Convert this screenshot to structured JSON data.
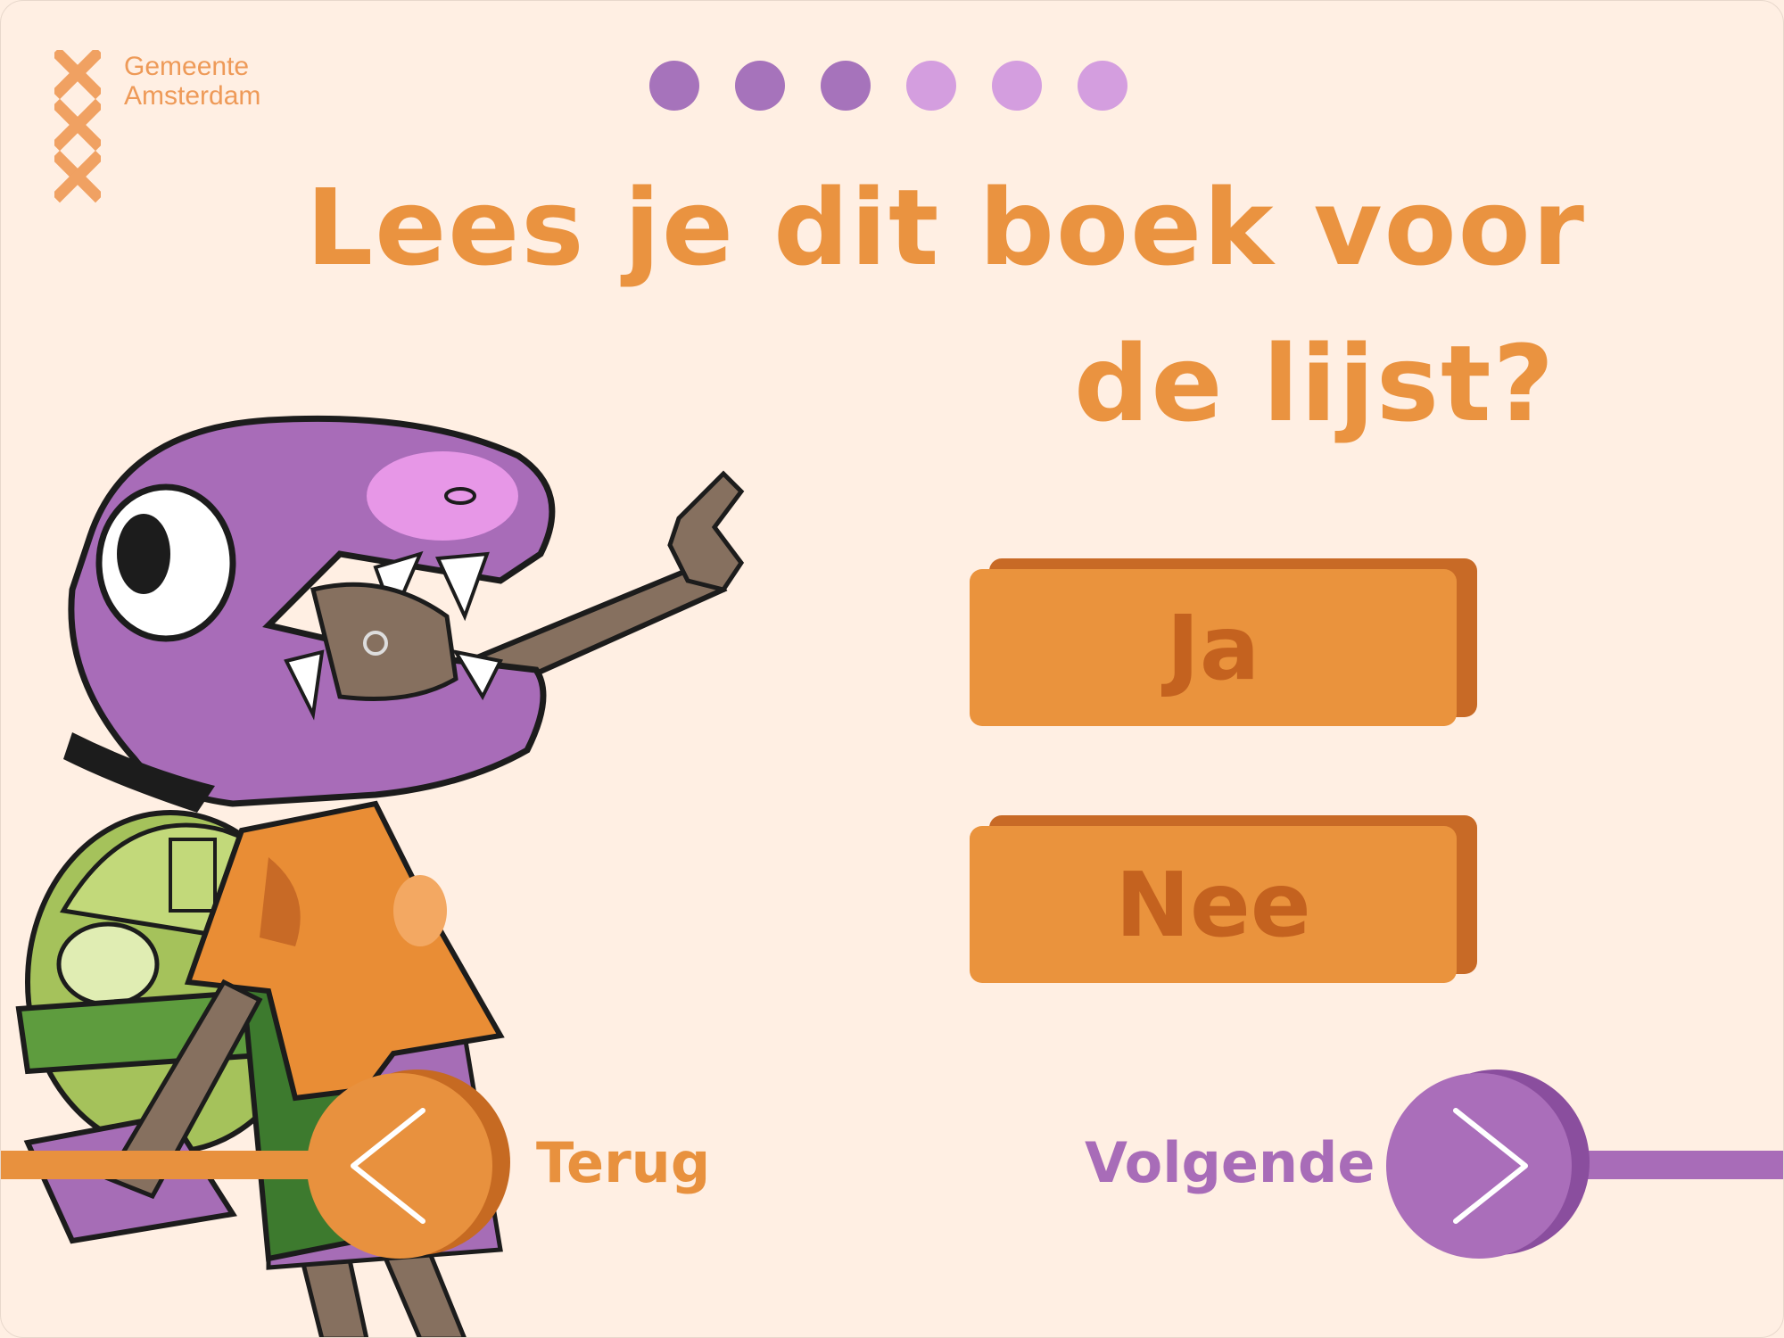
{
  "logo": {
    "line1": "Gemeente",
    "line2": "Amsterdam",
    "icon": "three-crosses-icon"
  },
  "progress": {
    "total": 6,
    "completed": 3,
    "colors": {
      "completed": "#A673BB",
      "remaining": "#D49EDF"
    }
  },
  "question": {
    "line1": "Lees je dit boek voor",
    "line2": "de lijst?"
  },
  "answers": {
    "yes_label": "Ja",
    "no_label": "Nee"
  },
  "navigation": {
    "back_label": "Terug",
    "next_label": "Volgende",
    "back_icon": "chevron-left-icon",
    "next_icon": "chevron-right-icon"
  },
  "colors": {
    "background": "#FFEFE3",
    "orange": "#EA933D",
    "purple": "#A86CB8"
  }
}
